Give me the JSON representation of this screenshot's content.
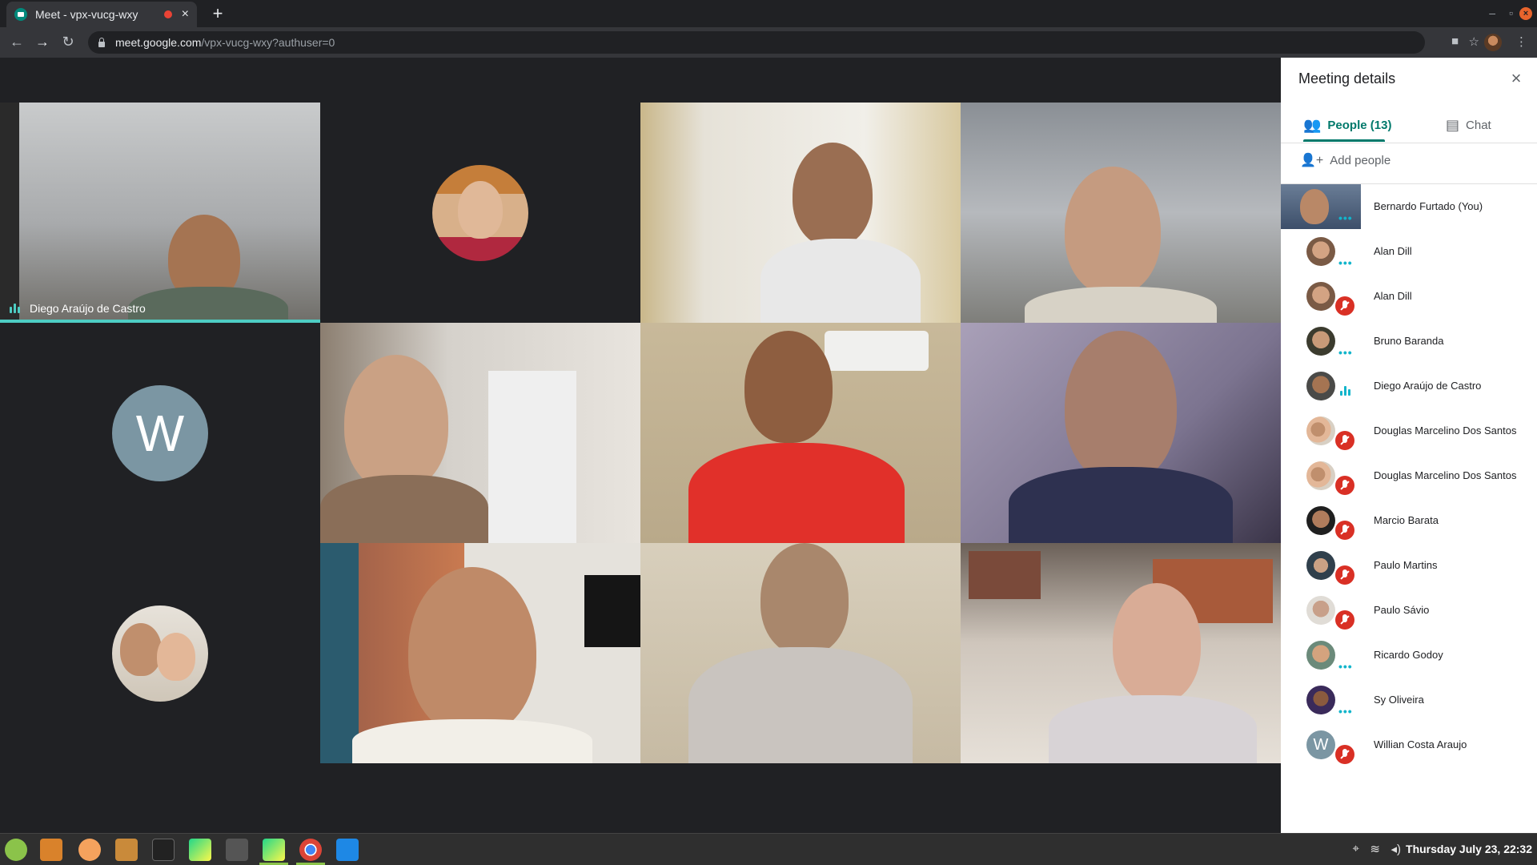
{
  "browser": {
    "tab_title": "Meet - vpx-vucg-wxy",
    "tab_close": "×",
    "new_tab": "+",
    "url_host": "meet.google.com",
    "url_path": "/vpx-vucg-wxy?authuser=0",
    "min_symbol": "–",
    "max_symbol": "▫",
    "close_symbol": "×"
  },
  "stage": {
    "active_speaker_label": "Diego Araújo de Castro",
    "letter_avatar": "W"
  },
  "panel": {
    "title": "Meeting details",
    "close_symbol": "×",
    "tab_people": "People (13)",
    "tab_chat": "Chat",
    "add_people": "Add people",
    "participants": [
      {
        "name": "Bernardo Furtado (You)",
        "status": "dots"
      },
      {
        "name": "Alan Dill",
        "status": "dots"
      },
      {
        "name": "Alan Dill",
        "status": "muted"
      },
      {
        "name": "Bruno Baranda",
        "status": "dots"
      },
      {
        "name": "Diego Araújo de Castro",
        "status": "speaking"
      },
      {
        "name": "Douglas Marcelino Dos Santos",
        "status": "muted"
      },
      {
        "name": "Douglas Marcelino Dos Santos",
        "status": "muted"
      },
      {
        "name": "Marcio Barata",
        "status": "muted"
      },
      {
        "name": "Paulo Martins",
        "status": "muted"
      },
      {
        "name": "Paulo Sávio",
        "status": "muted"
      },
      {
        "name": "Ricardo Godoy",
        "status": "dots"
      },
      {
        "name": "Sy Oliveira",
        "status": "dots"
      },
      {
        "name": "Willian Costa Araujo",
        "status": "muted"
      }
    ],
    "willian_avatar_letter": "W"
  },
  "taskbar": {
    "clock": "Thursday July 23, 22:32"
  },
  "colors": {
    "accent": "#00796b",
    "speaking": "#4ecdc4",
    "muted": "#d93025"
  }
}
